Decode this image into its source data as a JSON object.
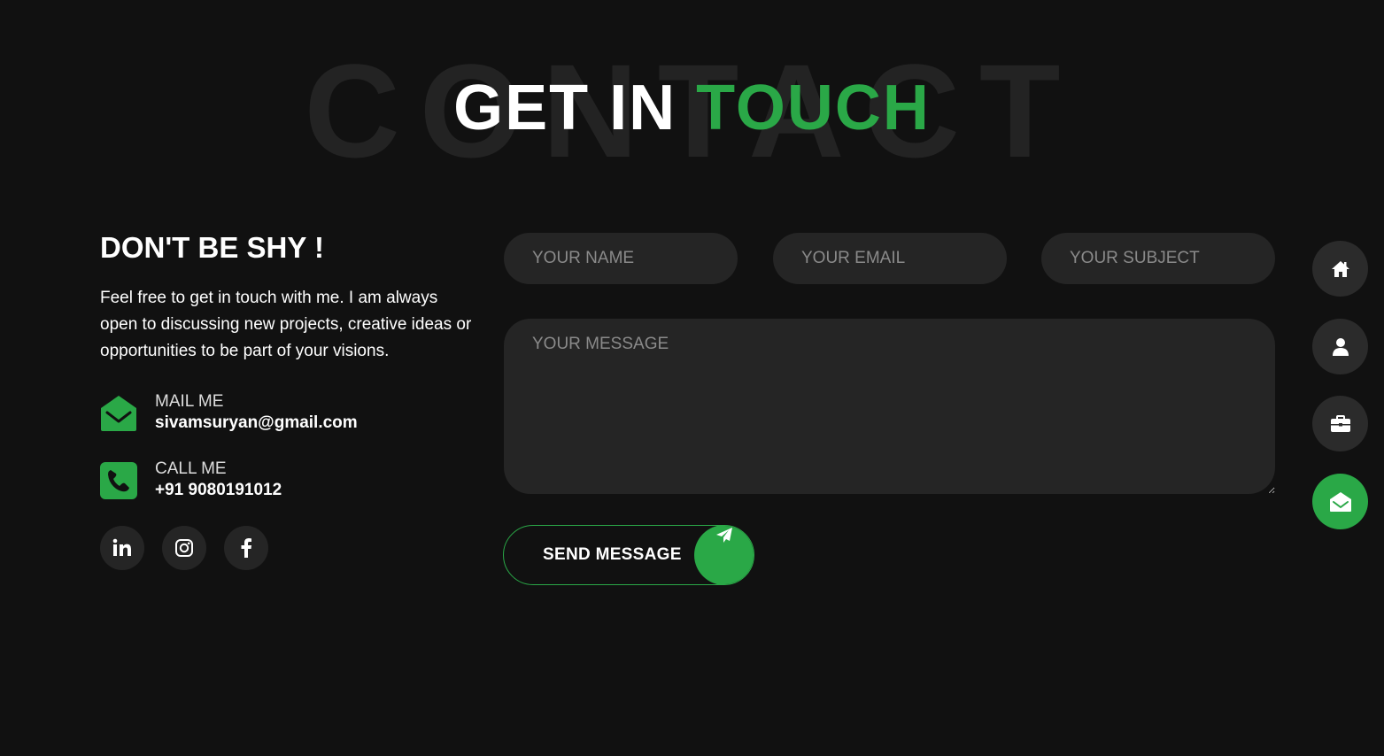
{
  "heading": {
    "background_word": "CONTACT",
    "title_white": "GET IN",
    "title_green": "TOUCH"
  },
  "info": {
    "title": "DON'T BE SHY !",
    "description": "Feel free to get in touch with me. I am always open to discussing new projects, creative ideas or opportunities to be part of your visions.",
    "mail": {
      "label": "MAIL ME",
      "value": "sivamsuryan@gmail.com",
      "icon": "envelope-open-icon"
    },
    "call": {
      "label": "CALL ME",
      "value": "+91 9080191012",
      "icon": "phone-icon"
    },
    "socials": [
      {
        "name": "linkedin",
        "icon": "linkedin-icon"
      },
      {
        "name": "instagram",
        "icon": "instagram-icon"
      },
      {
        "name": "facebook",
        "icon": "facebook-icon"
      }
    ]
  },
  "form": {
    "name_placeholder": "YOUR NAME",
    "email_placeholder": "YOUR EMAIL",
    "subject_placeholder": "YOUR SUBJECT",
    "message_placeholder": "YOUR MESSAGE",
    "submit_label": "SEND MESSAGE",
    "submit_icon": "paper-plane-icon"
  },
  "side_nav": [
    {
      "name": "home",
      "icon": "home-icon",
      "active": false
    },
    {
      "name": "about",
      "icon": "user-icon",
      "active": false
    },
    {
      "name": "portfolio",
      "icon": "briefcase-icon",
      "active": false
    },
    {
      "name": "contact",
      "icon": "envelope-open-icon",
      "active": true
    }
  ],
  "colors": {
    "background": "#111111",
    "accent": "#2aa847",
    "surface": "#252525",
    "placeholder": "#8a8a8a"
  }
}
